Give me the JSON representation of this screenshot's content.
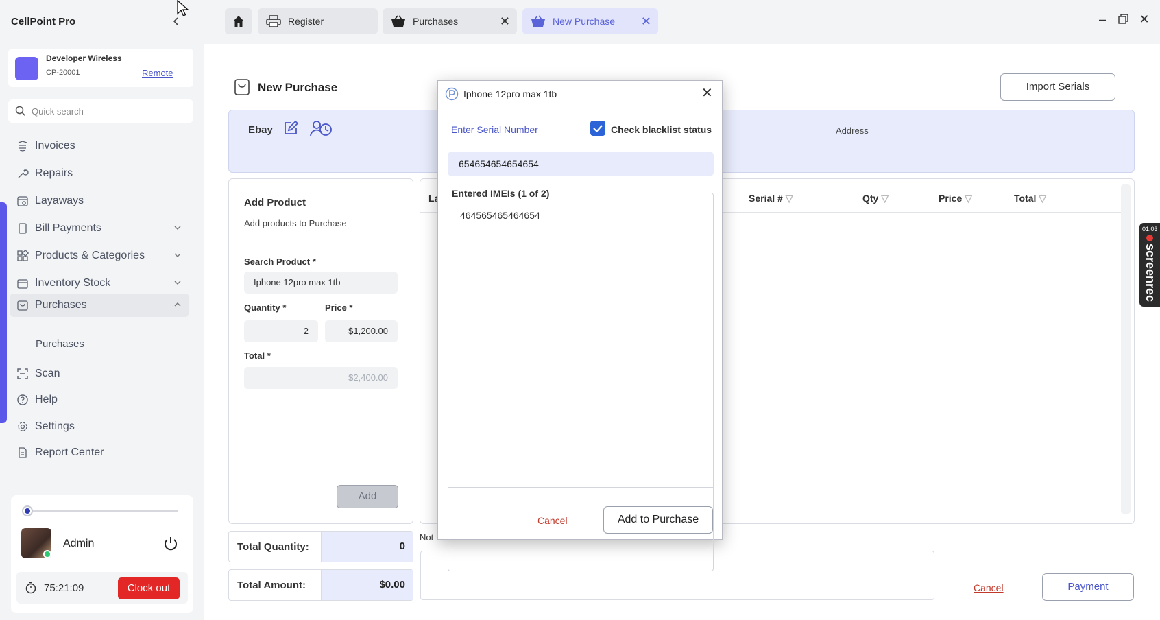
{
  "app": {
    "title": "CellPoint Pro"
  },
  "store": {
    "name": "Developer Wireless",
    "code": "CP-20001",
    "mode_link": "Remote"
  },
  "search": {
    "placeholder": "Quick search"
  },
  "sidebar": {
    "items": [
      {
        "label": "Invoices",
        "icon": "invoices-icon"
      },
      {
        "label": "Repairs",
        "icon": "wrench-icon"
      },
      {
        "label": "Layaways",
        "icon": "calendar-icon"
      },
      {
        "label": "Bill Payments",
        "icon": "bill-icon"
      },
      {
        "label": "Products & Categories",
        "icon": "grid-icon"
      },
      {
        "label": "Inventory Stock",
        "icon": "box-icon"
      },
      {
        "label": "Purchases",
        "icon": "bag-icon"
      },
      {
        "label": "Scan",
        "icon": "scan-icon"
      },
      {
        "label": "Help",
        "icon": "help-icon"
      },
      {
        "label": "Settings",
        "icon": "gear-icon"
      },
      {
        "label": "Report Center",
        "icon": "report-icon"
      }
    ],
    "sub_item": "Purchases"
  },
  "user": {
    "name": "Admin",
    "timer": "75:21:09",
    "clock_out": "Clock out"
  },
  "tabs": [
    {
      "label": "Register"
    },
    {
      "label": "Purchases"
    },
    {
      "label": "New Purchase"
    }
  ],
  "page": {
    "title": "New Purchase",
    "import_button": "Import Serials",
    "vendor": "Ebay",
    "address_label": "Address"
  },
  "add_product": {
    "title": "Add Product",
    "subtitle": "Add products to Purchase",
    "search_label": "Search Product *",
    "search_value": "Iphone 12pro max 1tb",
    "quantity_label": "Quantity *",
    "quantity_value": "2",
    "price_label": "Price *",
    "price_value": "$1,200.00",
    "total_label": "Total *",
    "total_value": "$2,400.00",
    "add_button": "Add"
  },
  "table": {
    "headers": [
      "La",
      "Serial #",
      "Qty",
      "Price",
      "Total"
    ]
  },
  "totals": {
    "qty_label": "Total Quantity:",
    "qty_value": "0",
    "amount_label": "Total Amount:",
    "amount_value": "$0.00"
  },
  "notes_label": "Not",
  "footer": {
    "cancel": "Cancel",
    "payment": "Payment"
  },
  "recorder": {
    "time": "01:03",
    "label": "screenrec"
  },
  "modal": {
    "title": "Iphone 12pro max 1tb",
    "serial_label": "Enter Serial Number",
    "blacklist_label": "Check blacklist status",
    "blacklist_checked": true,
    "serial_value": "654654654654654",
    "entered_legend": "Entered IMEIs (1 of 2)",
    "entered_imeis": [
      "464565465464654"
    ],
    "cancel": "Cancel",
    "submit": "Add to Purchase"
  },
  "colors": {
    "accent": "#5b57e8",
    "link": "#4a56c9",
    "danger": "#e32727",
    "panel": "#e7ebfb"
  }
}
